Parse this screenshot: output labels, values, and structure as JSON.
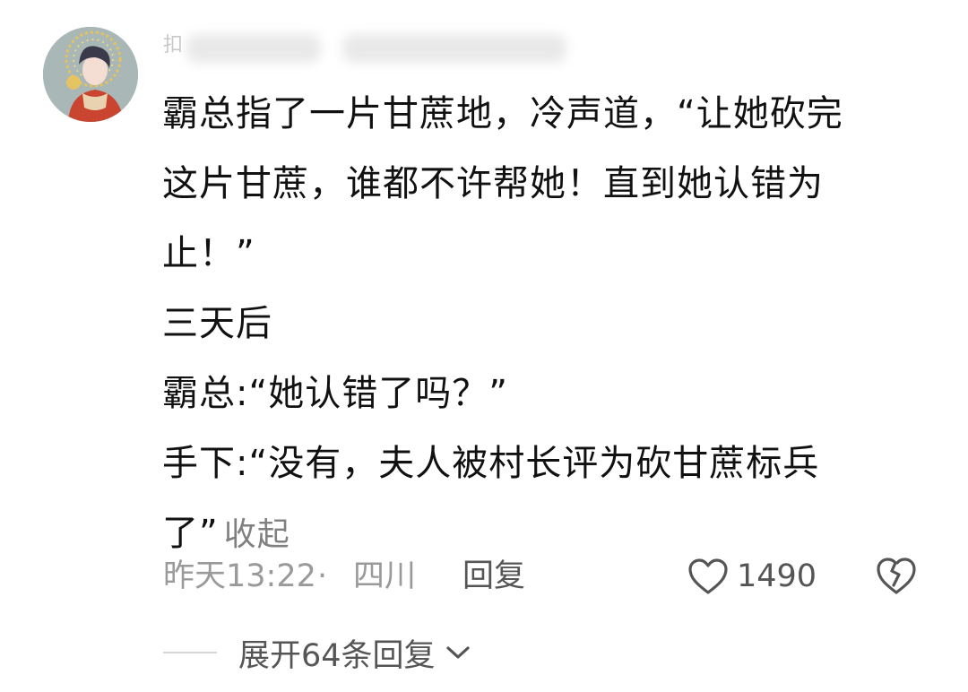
{
  "comment": {
    "username_partial": "扣",
    "text_lines": [
      "霸总指了一片甘蔗地，冷声道，“让她砍完",
      "这片甘蔗，谁都不许帮她！直到她认错为",
      "止！”",
      "三天后",
      "霸总:“她认错了吗？”",
      "手下:“没有，夫人被村长评为砍甘蔗标兵",
      "了”"
    ],
    "collapse_label": "收起",
    "timestamp": "昨天13:22",
    "separator": "·",
    "location": "四川",
    "reply_label": "回复",
    "like_count": "1490",
    "expand_label": "展开64条回复"
  },
  "colors": {
    "text_primary": "#111111",
    "text_secondary": "#9a9a9a",
    "text_action": "#555555",
    "divider": "#d5d5d5"
  },
  "icons": {
    "like": "heart-outline-icon",
    "dislike": "broken-heart-icon",
    "expand": "chevron-down-icon"
  }
}
